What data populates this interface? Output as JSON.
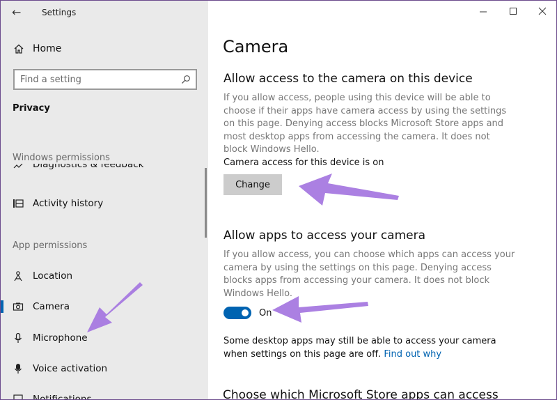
{
  "app": {
    "title": "Settings"
  },
  "sidebar": {
    "home": "Home",
    "search_placeholder": "Find a setting",
    "category": "Privacy",
    "windows_permissions": "Windows permissions",
    "cut_item": "Diagnostics & feedback",
    "activity_history": "Activity history",
    "app_permissions": "App permissions",
    "items": [
      {
        "label": "Location",
        "icon": "location-icon"
      },
      {
        "label": "Camera",
        "icon": "camera-icon",
        "active": true
      },
      {
        "label": "Microphone",
        "icon": "microphone-icon"
      },
      {
        "label": "Voice activation",
        "icon": "voice-activation-icon"
      },
      {
        "label": "Notifications",
        "icon": "notifications-icon"
      }
    ]
  },
  "main": {
    "title": "Camera",
    "device_section": {
      "heading": "Allow access to the camera on this device",
      "description": "If you allow access, people using this device will be able to choose if their apps have camera access by using the settings on this page. Denying access blocks Microsoft Store apps and most desktop apps from accessing the camera. It does not block Windows Hello.",
      "status": "Camera access for this device is on",
      "button": "Change"
    },
    "apps_section": {
      "heading": "Allow apps to access your camera",
      "description": "If you allow access, you can choose which apps can access your camera by using the settings on this page. Denying access blocks apps from accessing your camera. It does not block Windows Hello.",
      "toggle_label": "On",
      "toggle_on": true,
      "note": "Some desktop apps may still be able to access your camera when settings on this page are off.",
      "link": "Find out why"
    },
    "next_heading": "Choose which Microsoft Store apps can access"
  },
  "colors": {
    "accent": "#0063b1",
    "arrow": "#a779e0",
    "sidebar_bg": "#eaeaea"
  }
}
